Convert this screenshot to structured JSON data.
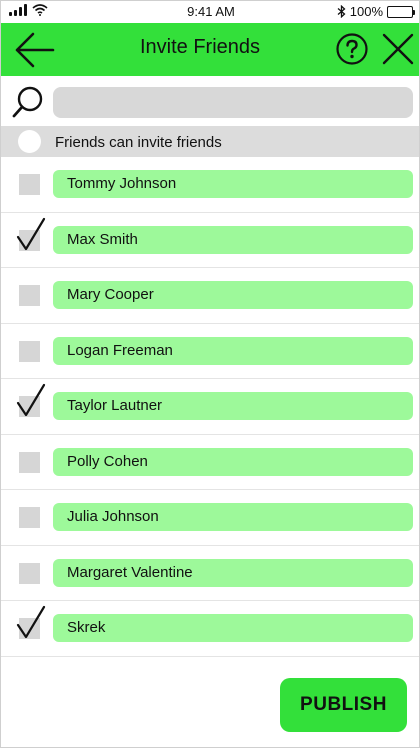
{
  "status_bar": {
    "time": "9:41 AM",
    "battery": "100%"
  },
  "header": {
    "title": "Invite Friends"
  },
  "search": {
    "placeholder": "",
    "value": ""
  },
  "option": {
    "label": "Friends can invite friends",
    "enabled": false
  },
  "friends": [
    {
      "name": "Tommy Johnson",
      "checked": false
    },
    {
      "name": "Max Smith",
      "checked": true
    },
    {
      "name": "Mary Cooper",
      "checked": false
    },
    {
      "name": "Logan Freeman",
      "checked": false
    },
    {
      "name": "Taylor Lautner",
      "checked": true
    },
    {
      "name": "Polly Cohen",
      "checked": false
    },
    {
      "name": "Julia Johnson",
      "checked": false
    },
    {
      "name": "Margaret Valentine",
      "checked": false
    },
    {
      "name": "Skrek",
      "checked": true
    }
  ],
  "actions": {
    "publish_label": "PUBLISH"
  },
  "colors": {
    "accent": "#33e03a",
    "pill": "#9df99a",
    "control_gray": "#d8d8d8"
  },
  "icons": {
    "back": "arrow-left-icon",
    "help": "question-circle-icon",
    "close": "close-icon",
    "search": "search-icon",
    "check": "checkmark-icon"
  }
}
